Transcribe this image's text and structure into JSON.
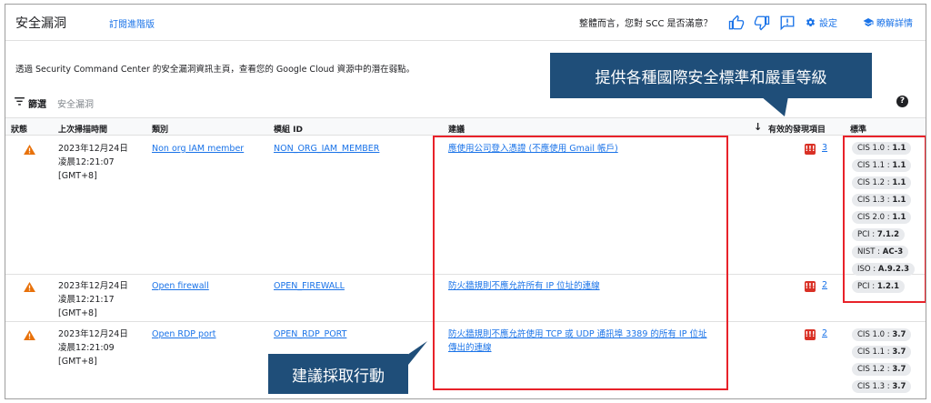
{
  "header": {
    "title": "安全漏洞",
    "upgrade": "訂閱進階版",
    "survey": "整體而言，您對 SCC 是否滿意？",
    "settings": "設定",
    "learn_more": "瞭解詳情"
  },
  "intro": "透過 Security Command Center 的安全漏洞資訊主頁，查看您的 Google Cloud 資源中的潛在弱點。",
  "filter": {
    "label": "篩選",
    "placeholder": "安全漏洞"
  },
  "table": {
    "columns": {
      "status": "狀態",
      "last_scan": "上次掃描時間",
      "category": "類別",
      "module_id": "模組 ID",
      "recommendation": "建議",
      "active_findings": "有效的發現項目",
      "standards": "標準"
    },
    "rows": [
      {
        "date": "2023年12月24日",
        "time": "凌晨12:21:07",
        "tz": "[GMT+8]",
        "category": "Non org IAM member",
        "module": "NON_ORG_IAM_MEMBER",
        "recommendation": "應使用公司登入憑證 (不應使用 Gmail 帳戶)",
        "severity": "!!!",
        "count": "3",
        "standards": [
          {
            "name": "CIS 1.0 : ",
            "value": "1.1"
          },
          {
            "name": "CIS 1.1 : ",
            "value": "1.1"
          },
          {
            "name": "CIS 1.2 : ",
            "value": "1.1"
          },
          {
            "name": "CIS 1.3 : ",
            "value": "1.1"
          },
          {
            "name": "CIS 2.0 : ",
            "value": "1.1"
          },
          {
            "name": "PCI : ",
            "value": "7.1.2"
          },
          {
            "name": "NIST : ",
            "value": "AC-3"
          },
          {
            "name": "ISO : ",
            "value": "A.9.2.3"
          }
        ]
      },
      {
        "date": "2023年12月24日",
        "time": "凌晨12:21:17",
        "tz": "[GMT+8]",
        "category": "Open firewall",
        "module": "OPEN_FIREWALL",
        "recommendation": "防火牆規則不應允許所有 IP 位址的連線",
        "severity": "!!!",
        "count": "2",
        "standards": [
          {
            "name": "PCI : ",
            "value": "1.2.1"
          }
        ]
      },
      {
        "date": "2023年12月24日",
        "time": "凌晨12:21:09",
        "tz": "[GMT+8]",
        "category": "Open RDP port",
        "module": "OPEN_RDP_PORT",
        "recommendation": "防火牆規則不應允許使用 TCP 或 UDP 通訊埠 3389 的所有 IP 位址",
        "recommendation2": "傳出的連線",
        "severity": "!!!",
        "count": "2",
        "standards": [
          {
            "name": "CIS 1.0 : ",
            "value": "3.7"
          },
          {
            "name": "CIS 1.1 : ",
            "value": "3.7"
          },
          {
            "name": "CIS 1.2 : ",
            "value": "3.7"
          },
          {
            "name": "CIS 1.3 : ",
            "value": "3.7"
          }
        ]
      }
    ]
  },
  "callouts": {
    "standards": "提供各種國際安全標準和嚴重等級",
    "action": "建議採取行動"
  },
  "colors": {
    "accent": "#1a73e8",
    "warning": "#e8710a",
    "severity": "#d93025",
    "callout_bg": "#1f4e79",
    "highlight": "#e8222a"
  }
}
